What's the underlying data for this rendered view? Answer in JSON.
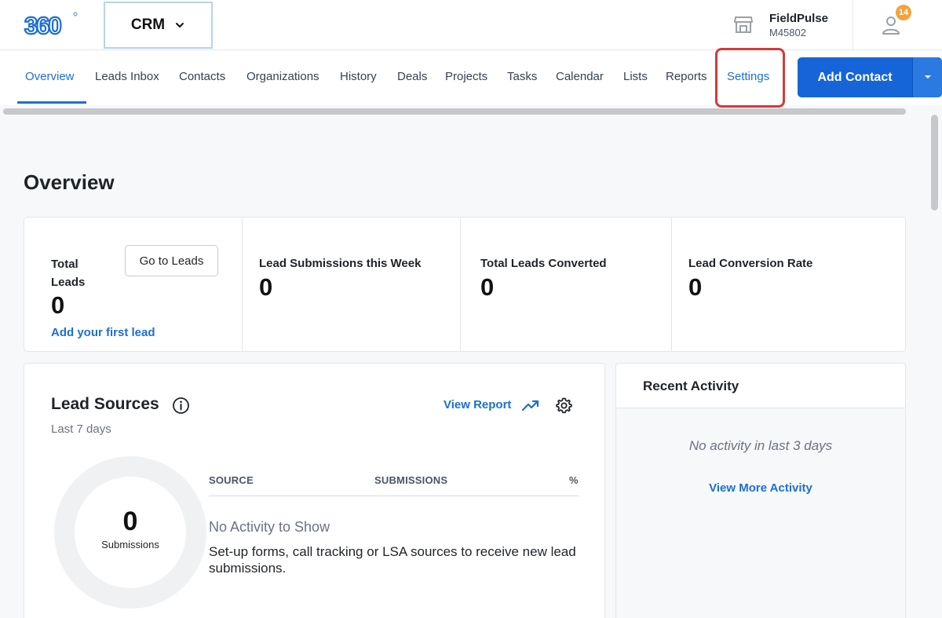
{
  "header": {
    "app_selector": "CRM",
    "company_name": "FieldPulse",
    "company_code": "M45802",
    "notification_count": "14"
  },
  "nav": {
    "tabs": [
      {
        "label": "Overview",
        "active": true
      },
      {
        "label": "Leads Inbox"
      },
      {
        "label": "Contacts"
      },
      {
        "label": "Organizations"
      },
      {
        "label": "History"
      },
      {
        "label": "Deals"
      },
      {
        "label": "Projects"
      },
      {
        "label": "Tasks"
      },
      {
        "label": "Calendar"
      },
      {
        "label": "Lists"
      },
      {
        "label": "Reports"
      },
      {
        "label": "Settings"
      }
    ],
    "add_contact_label": "Add Contact"
  },
  "page": {
    "title": "Overview"
  },
  "stats": {
    "total_leads_title": "Total Leads",
    "total_leads_value": "0",
    "go_to_leads_label": "Go to Leads",
    "add_first_lead_label": "Add your first lead",
    "week_title": "Lead Submissions this Week",
    "week_value": "0",
    "converted_title": "Total Leads Converted",
    "converted_value": "0",
    "rate_title": "Lead Conversion Rate",
    "rate_value": "0"
  },
  "lead_sources": {
    "title": "Lead Sources",
    "subtitle": "Last 7 days",
    "view_report_label": "View Report",
    "donut_value": "0",
    "donut_label": "Submissions",
    "columns": [
      "SOURCE",
      "SUBMISSIONS",
      "%"
    ],
    "empty_title": "No Activity to Show",
    "empty_desc": "Set-up forms, call tracking or LSA sources to receive new lead submissions."
  },
  "recent_activity": {
    "title": "Recent Activity",
    "empty_text": "No activity in last 3 days",
    "view_more_label": "View More Activity"
  },
  "colors": {
    "accent": "#1d6fd1",
    "primary_button": "#1565d8",
    "badge": "#f4a23a",
    "highlight": "#d23b3b"
  }
}
